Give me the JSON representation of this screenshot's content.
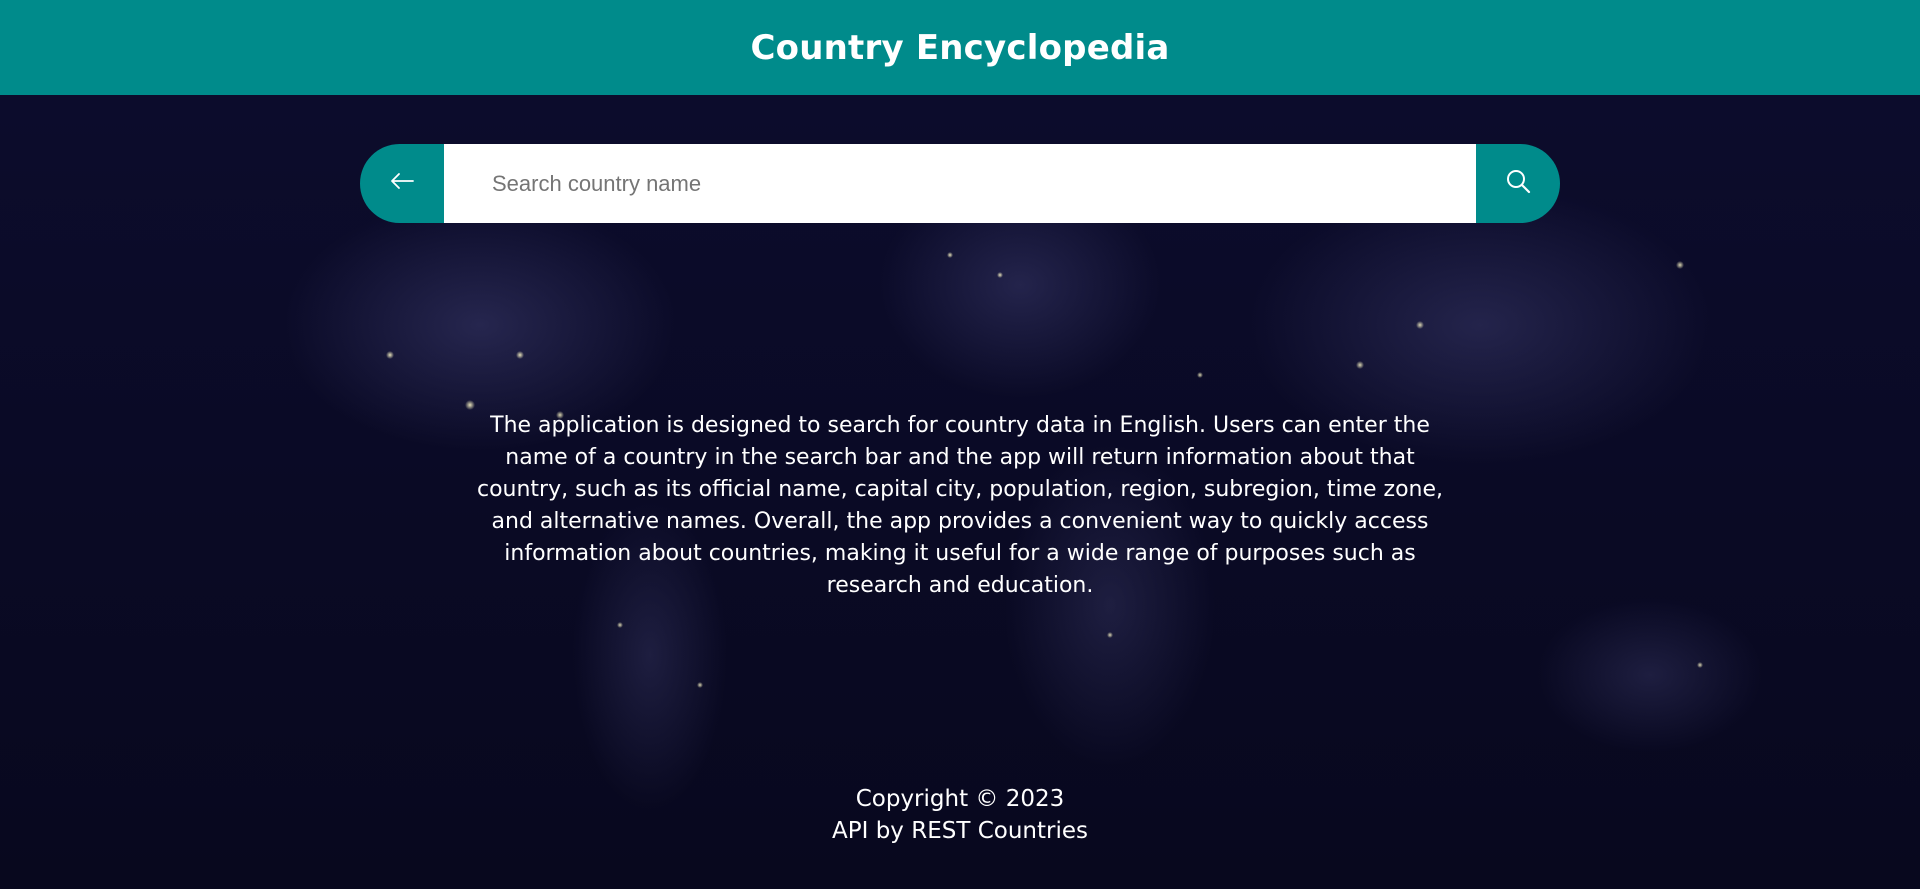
{
  "header": {
    "title": "Country Encyclopedia"
  },
  "search": {
    "placeholder": "Search country name",
    "value": "",
    "back_icon": "arrow-left-icon",
    "search_icon": "search-icon"
  },
  "main": {
    "description": "The application is designed to search for country data in English. Users can enter the name of a country in the search bar and the app will return information about that country, such as its official name, capital city, population, region, subregion, time zone, and alternative names. Overall, the app provides a convenient way to quickly access information about countries, making it useful for a wide range of purposes such as research and education."
  },
  "footer": {
    "copyright": "Copyright © 2023",
    "api_credit": "API by REST Countries"
  },
  "colors": {
    "accent": "#008b8b",
    "background": "#0a0a2a",
    "text": "#ffffff"
  }
}
